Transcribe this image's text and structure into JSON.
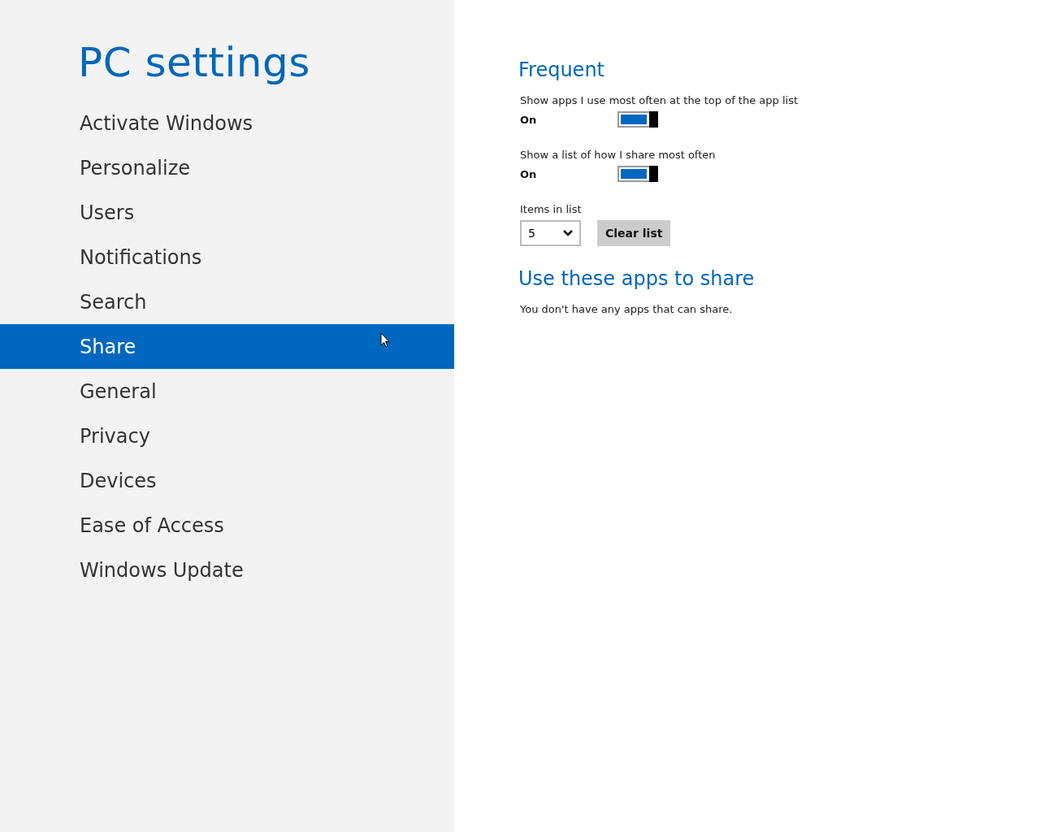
{
  "sidebar": {
    "title": "PC settings",
    "items": [
      {
        "label": "Activate Windows",
        "selected": false
      },
      {
        "label": "Personalize",
        "selected": false
      },
      {
        "label": "Users",
        "selected": false
      },
      {
        "label": "Notifications",
        "selected": false
      },
      {
        "label": "Search",
        "selected": false
      },
      {
        "label": "Share",
        "selected": true
      },
      {
        "label": "General",
        "selected": false
      },
      {
        "label": "Privacy",
        "selected": false
      },
      {
        "label": "Devices",
        "selected": false
      },
      {
        "label": "Ease of Access",
        "selected": false
      },
      {
        "label": "Windows Update",
        "selected": false
      }
    ]
  },
  "sections": [
    {
      "heading": "Frequent",
      "settings": [
        {
          "kind": "toggle",
          "label": "Show apps I use most often at the top of the app list",
          "state_text": "On",
          "on": true
        },
        {
          "kind": "toggle",
          "label": "Show a list of how I share most often",
          "state_text": "On",
          "on": true
        },
        {
          "kind": "list",
          "label": "Items in list",
          "value": "5",
          "button": "Clear list"
        }
      ]
    },
    {
      "heading": "Use these apps to share",
      "settings": [
        {
          "kind": "note",
          "text": "You don't have any apps that can share."
        }
      ]
    }
  ]
}
